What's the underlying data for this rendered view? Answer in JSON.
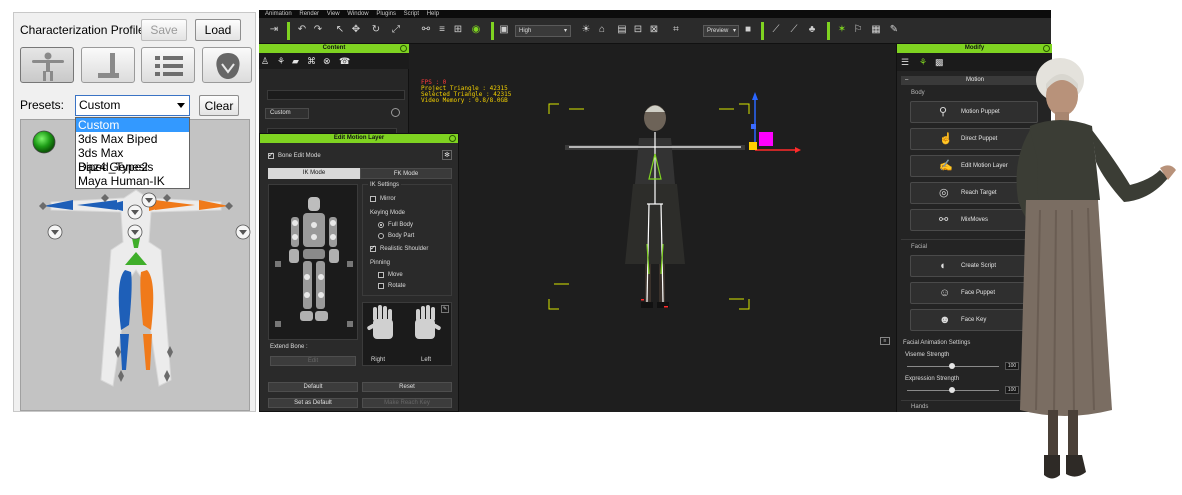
{
  "characterization": {
    "title": "Characterization Profile",
    "save_label": "Save",
    "load_label": "Load",
    "presets_label": "Presets:",
    "selected_preset": "Custom",
    "clear_label": "Clear",
    "preset_options": [
      "Custom",
      "3ds Max Biped",
      "3ds Max Biped_Type2",
      "Daz4 Genesis",
      "Maya Human-IK"
    ]
  },
  "menu": {
    "items": [
      "Animation",
      "Render",
      "View",
      "Window",
      "Plugins",
      "Script",
      "Help"
    ]
  },
  "toolbar": {
    "quality": "High",
    "preview": "Preview"
  },
  "content": {
    "title": "Content",
    "folder_label": "Custom"
  },
  "viewport": {
    "fps": "FPS : 0",
    "project_triangle": "Project Triangle : 42315",
    "selected_triangle": "Selected Triangle : 42315",
    "video_memory": "Video Memory : 0.8/8.0GB"
  },
  "edit_motion_layer": {
    "title": "Edit Motion Layer",
    "bone_edit_mode": "Bone Edit Mode",
    "ik_mode": "IK Mode",
    "fk_mode": "FK Mode",
    "ik_settings": "IK Settings",
    "mirror": "Mirror",
    "keying_mode": "Keying Mode",
    "full_body": "Full Body",
    "body_part": "Body Part",
    "realistic_shoulder": "Realistic Shoulder",
    "pinning": "Pinning",
    "move": "Move",
    "rotate": "Rotate",
    "extend_bone": "Extend Bone :",
    "edit": "Edit",
    "right": "Right",
    "left": "Left",
    "default": "Default",
    "reset": "Reset",
    "set_as_default": "Set as Default",
    "disabled_key": "Make Reach Key"
  },
  "modify": {
    "title": "Modify",
    "motion_header": "Motion",
    "body_section": "Body",
    "motion_puppet": "Motion Puppet",
    "direct_puppet": "Direct Puppet",
    "edit_motion_layer": "Edit Motion Layer",
    "reach_target": "Reach Target",
    "mixmoves": "MixMoves",
    "facial_section": "Facial",
    "create_script": "Create Script",
    "face_puppet": "Face Puppet",
    "face_key": "Face Key",
    "facial_anim_settings": "Facial Animation Settings",
    "viseme_strength": "Viseme Strength",
    "viseme_value": "100",
    "expression_strength": "Expression Strength",
    "expression_value": "100",
    "bottom_section": "Hands"
  },
  "colors": {
    "accent_green": "#7fd321",
    "left_limb_blue": "#1e5fb8",
    "right_limb_orange": "#f07a1a",
    "spine_green": "#3fae2a",
    "stats_yellow": "#f3d000",
    "selection_blue": "#3399ff"
  }
}
